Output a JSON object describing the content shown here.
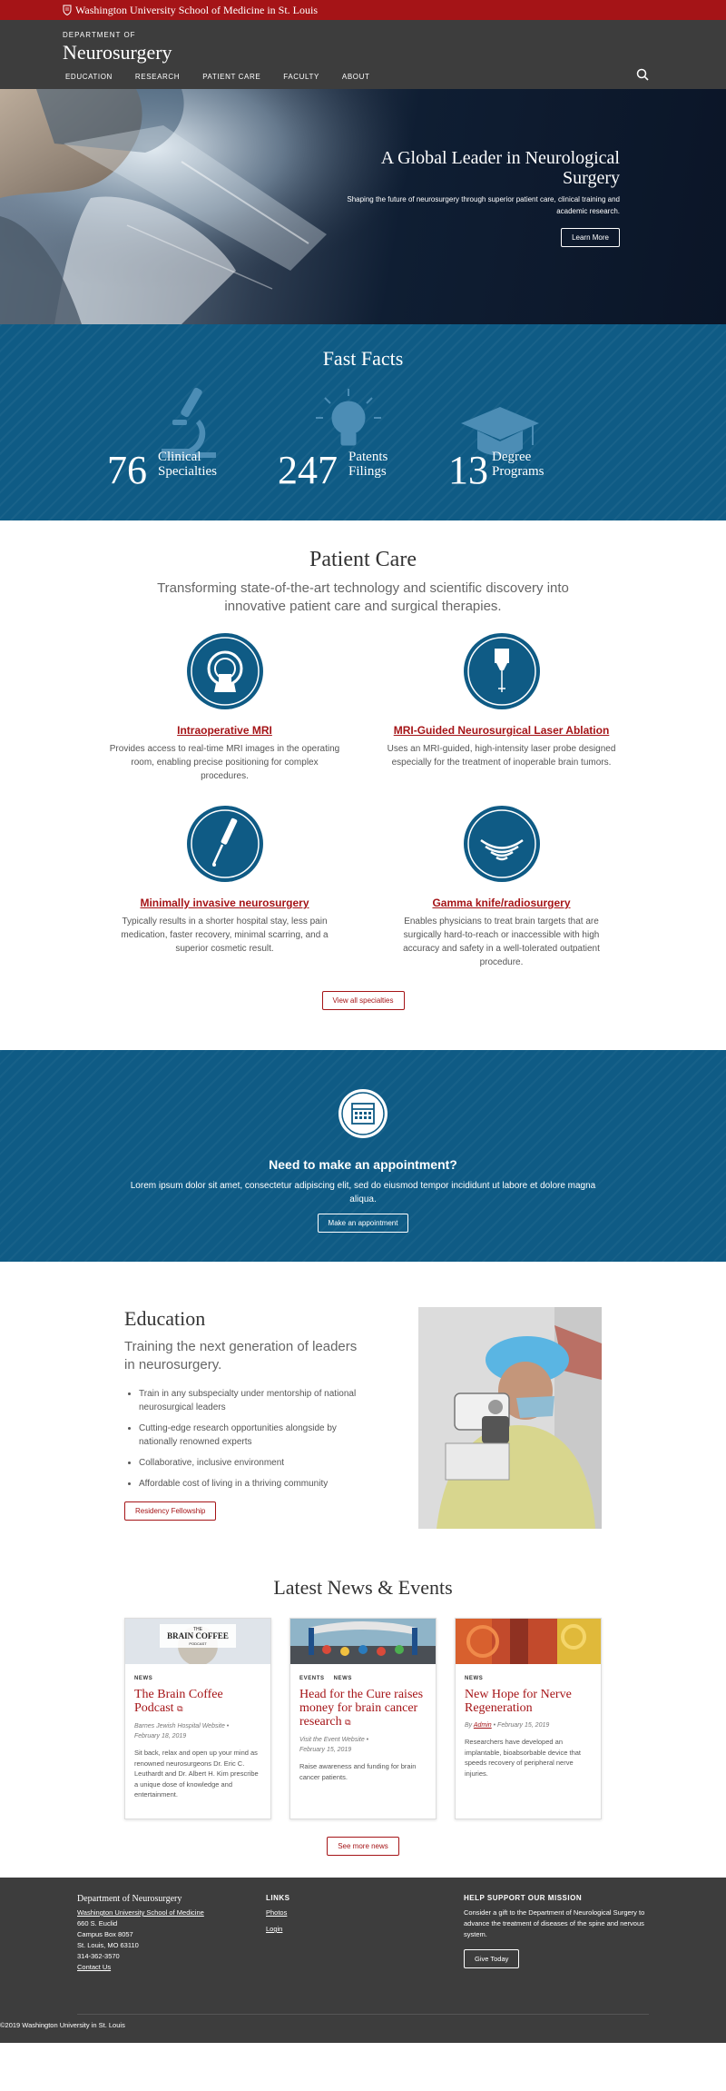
{
  "university": {
    "name": "Washington University School of Medicine in St. Louis"
  },
  "header": {
    "dept_small": "DEPARTMENT OF",
    "dept_name": "Neurosurgery",
    "nav": [
      "EDUCATION",
      "RESEARCH",
      "PATIENT CARE",
      "FACULTY",
      "ABOUT"
    ]
  },
  "hero": {
    "title": "A Global Leader in Neurological Surgery",
    "subtitle": "Shaping the future of neurosurgery through superior patient care, clinical training and academic research.",
    "button": "Learn More"
  },
  "facts": {
    "title": "Fast Facts",
    "items": [
      {
        "number": "76",
        "label1": "Clinical",
        "label2": "Specialties"
      },
      {
        "number": "247",
        "label1": "Patents",
        "label2": "Filings"
      },
      {
        "number": "13",
        "label1": "Degree",
        "label2": "Programs"
      }
    ]
  },
  "patient_care": {
    "title": "Patient Care",
    "subtitle": "Transforming state-of-the-art technology and scientific discovery into innovative patient care and surgical therapies.",
    "items": [
      {
        "title": "Intraoperative MRI",
        "desc": "Provides access to real-time MRI images in the operating room, enabling precise positioning for complex procedures."
      },
      {
        "title": "MRI-Guided Neurosurgical Laser Ablation",
        "desc": "Uses an MRI-guided, high-intensity laser probe designed especially for the treatment of inoperable brain tumors."
      },
      {
        "title": "Minimally invasive neurosurgery",
        "desc": "Typically results in a shorter hospital stay, less pain medication, faster recovery, minimal scarring, and a superior cosmetic result."
      },
      {
        "title": "Gamma knife/radiosurgery",
        "desc": "Enables physicians to treat brain targets that are surgically hard-to-reach or inaccessible with high accuracy and safety in a well-tolerated outpatient procedure."
      }
    ],
    "button": "View all specialties"
  },
  "appointment": {
    "title": "Need to make an appointment?",
    "text": "Lorem ipsum dolor sit amet, consectetur adipiscing elit, sed do eiusmod tempor incididunt ut labore et dolore magna aliqua.",
    "button": "Make an appointment"
  },
  "education": {
    "title": "Education",
    "subtitle": "Training the next generation of leaders in neurosurgery.",
    "bullets": [
      "Train in any subspecialty under mentorship of national neurosurgical leaders",
      "Cutting-edge research opportunities alongside by nationally renowned experts",
      "Collaborative, inclusive environment",
      "Affordable cost of living in a thriving community"
    ],
    "button": "Residency Fellowship"
  },
  "news": {
    "title": "Latest News & Events",
    "cards": [
      {
        "tags": [
          "NEWS"
        ],
        "headline": "The Brain Coffee Podcast",
        "meta1": "Barnes Jewish Hospital Website •",
        "meta2": "February 18, 2019",
        "text": "Sit back, relax and open up your mind as renowned neurosurgeons Dr. Eric C. Leuthardt and Dr. Albert H. Kim prescribe a unique dose of knowledge and entertainment.",
        "thumb_text1": "THE",
        "thumb_text2": "BRAIN COFFEE",
        "thumb_text3": "PODCAST"
      },
      {
        "tags": [
          "EVENTS",
          "NEWS"
        ],
        "headline": "Head for the Cure raises money for brain cancer research",
        "meta1": "Visit the Event Website •",
        "meta2": "February 15, 2019",
        "text": "Raise awareness and funding for brain cancer patients."
      },
      {
        "tags": [
          "NEWS"
        ],
        "headline": "New Hope for Nerve Regeneration",
        "meta_by": "By",
        "meta_author": "Admin",
        "meta_date": "• February 15, 2019",
        "text": "Researchers have developed an implantable, bioabsorbable device that speeds recovery of peripheral nerve injuries."
      }
    ],
    "button": "See more news"
  },
  "footer": {
    "dept": "Department of Neurosurgery",
    "school_link": "Washington University School of Medicine",
    "addr1": "660 S. Euclid",
    "addr2": "Campus Box 8057",
    "addr3": "St. Louis, MO 63110",
    "phone": "314-362-3570",
    "contact": "Contact Us",
    "links_head": "LINKS",
    "links": [
      "Photos",
      "Login"
    ],
    "support_head": "HELP SUPPORT OUR MISSION",
    "support_text": "Consider a gift to the Department of Neurological Surgery to advance the treatment of diseases of the spine and nervous system.",
    "give_button": "Give Today",
    "copyright": "©2019 Washington University in St. Louis"
  },
  "colors": {
    "brand_red": "#a51417",
    "brand_blue": "#0f5b85",
    "dark_gray": "#3d3d3d"
  }
}
